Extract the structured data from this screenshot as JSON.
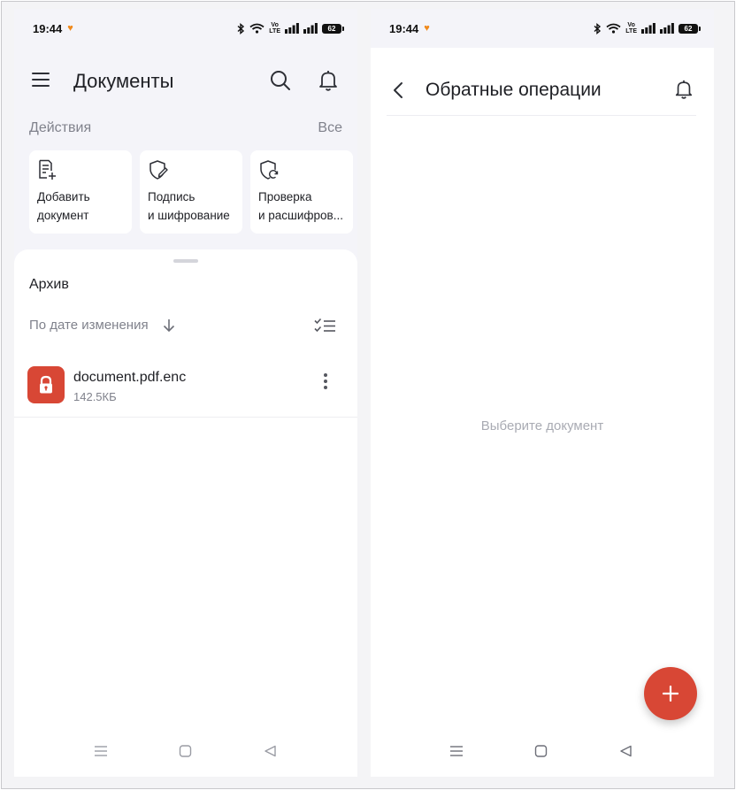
{
  "status_bar": {
    "time": "19:44",
    "volte_top": "Vo",
    "volte_bottom": "LTE",
    "battery": "62"
  },
  "left_screen": {
    "title": "Документы",
    "actions": {
      "title": "Действия",
      "all_label": "Все",
      "cards": [
        {
          "line1": "Добавить",
          "line2": "документ",
          "icon": "add-document-icon"
        },
        {
          "line1": "Подпись",
          "line2": "и шифрование",
          "icon": "shield-pen-icon"
        },
        {
          "line1": "Проверка",
          "line2": "и расшифров...",
          "icon": "shield-refresh-icon"
        }
      ]
    },
    "archive": {
      "title": "Архив",
      "sort_label": "По дате изменения",
      "files": [
        {
          "name": "document.pdf.enc",
          "size": "142.5КБ",
          "icon": "lock-icon"
        }
      ]
    }
  },
  "right_screen": {
    "title": "Обратные операции",
    "empty_text": "Выберите документ",
    "fab_label": "+"
  },
  "colors": {
    "accent": "#d84735",
    "background": "#f4f4f9",
    "muted_text": "#80828c",
    "status_heart": "#f08a1c"
  }
}
